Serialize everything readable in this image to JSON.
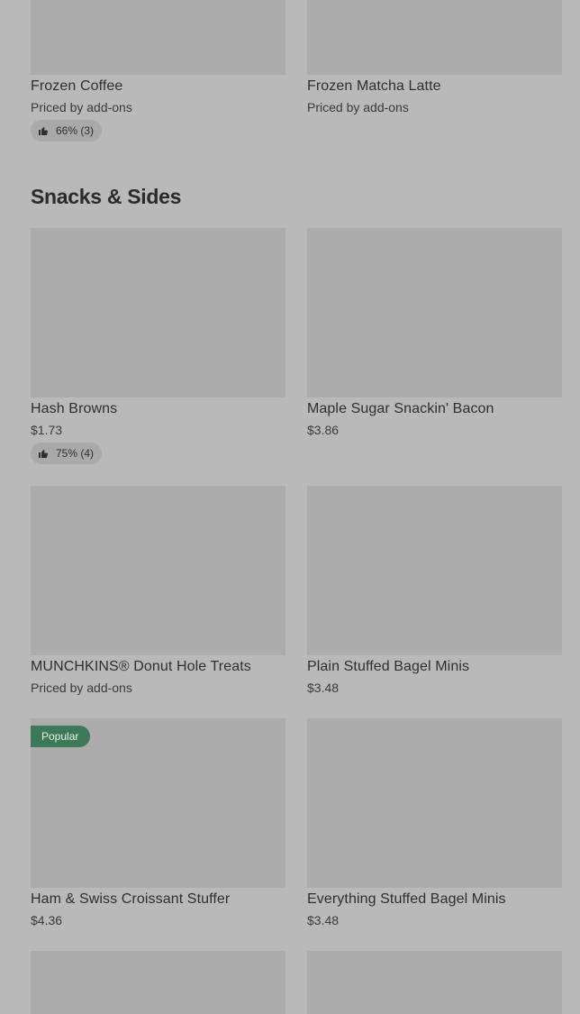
{
  "top_items": [
    {
      "name": "Frozen Coffee",
      "price": "Priced by add-ons",
      "rating": "66% (3)"
    },
    {
      "name": "Frozen Matcha Latte",
      "price": "Priced by add-ons"
    }
  ],
  "section": {
    "title": "Snacks & Sides"
  },
  "items": [
    {
      "name": "Hash Browns",
      "price": "$1.73",
      "rating": "75% (4)"
    },
    {
      "name": "Maple Sugar Snackin' Bacon",
      "price": "$3.86"
    },
    {
      "name": "MUNCHKINS® Donut Hole Treats",
      "price": "Priced by add-ons"
    },
    {
      "name": "Plain Stuffed Bagel Minis",
      "price": "$3.48"
    },
    {
      "name": "Ham & Swiss Croissant Stuffer",
      "price": "$4.36",
      "badge": "Popular"
    },
    {
      "name": "Everything Stuffed Bagel Minis",
      "price": "$3.48"
    }
  ],
  "icons": {
    "rating": "thumbs-up-icon"
  },
  "colors": {
    "background": "#b9b9b9",
    "image_placeholder": "#acacac",
    "badge": "#3b7a57"
  }
}
